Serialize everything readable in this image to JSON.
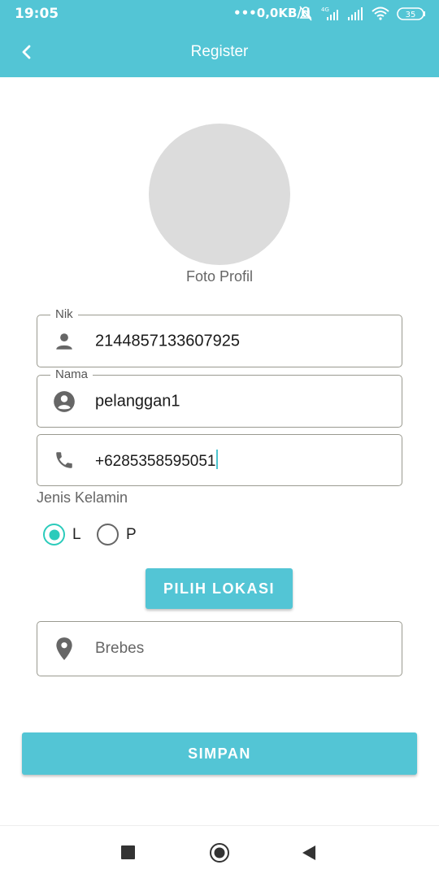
{
  "status_bar": {
    "time": "19:05",
    "network_speed": "•••0,0KB/d",
    "network_type": "4G",
    "battery": "35",
    "icons": [
      "dots-icon",
      "mute-bell-icon",
      "signal-4g-icon",
      "signal-icon",
      "wifi-icon",
      "battery-icon"
    ]
  },
  "app_bar": {
    "title": "Register",
    "back_icon": "back-arrow-icon",
    "background_color": "#53c5d5"
  },
  "profile_photo": {
    "caption": "Foto Profil"
  },
  "form": {
    "nik": {
      "label": "Nik",
      "value": "2144857133607925",
      "icon": "person-icon"
    },
    "nama": {
      "label": "Nama",
      "value": "pelanggan1",
      "icon": "account-circle-icon"
    },
    "phone": {
      "value": "+6285358595051",
      "icon": "phone-icon"
    },
    "gender": {
      "label": "Jenis Kelamin",
      "options": [
        {
          "label": "L",
          "checked": true
        },
        {
          "label": "P",
          "checked": false
        }
      ]
    },
    "pick_location_button": "PILIH LOKASI",
    "location": {
      "value": "Brebes",
      "icon": "location-pin-icon"
    },
    "save_button": "SIMPAN"
  },
  "nav_bar": {
    "items": [
      "recents-square-icon",
      "home-circle-icon",
      "back-triangle-icon"
    ]
  },
  "colors": {
    "accent": "#53c5d5",
    "radio_checked": "#2bcbbb",
    "cursor": "#4cc4cf"
  }
}
